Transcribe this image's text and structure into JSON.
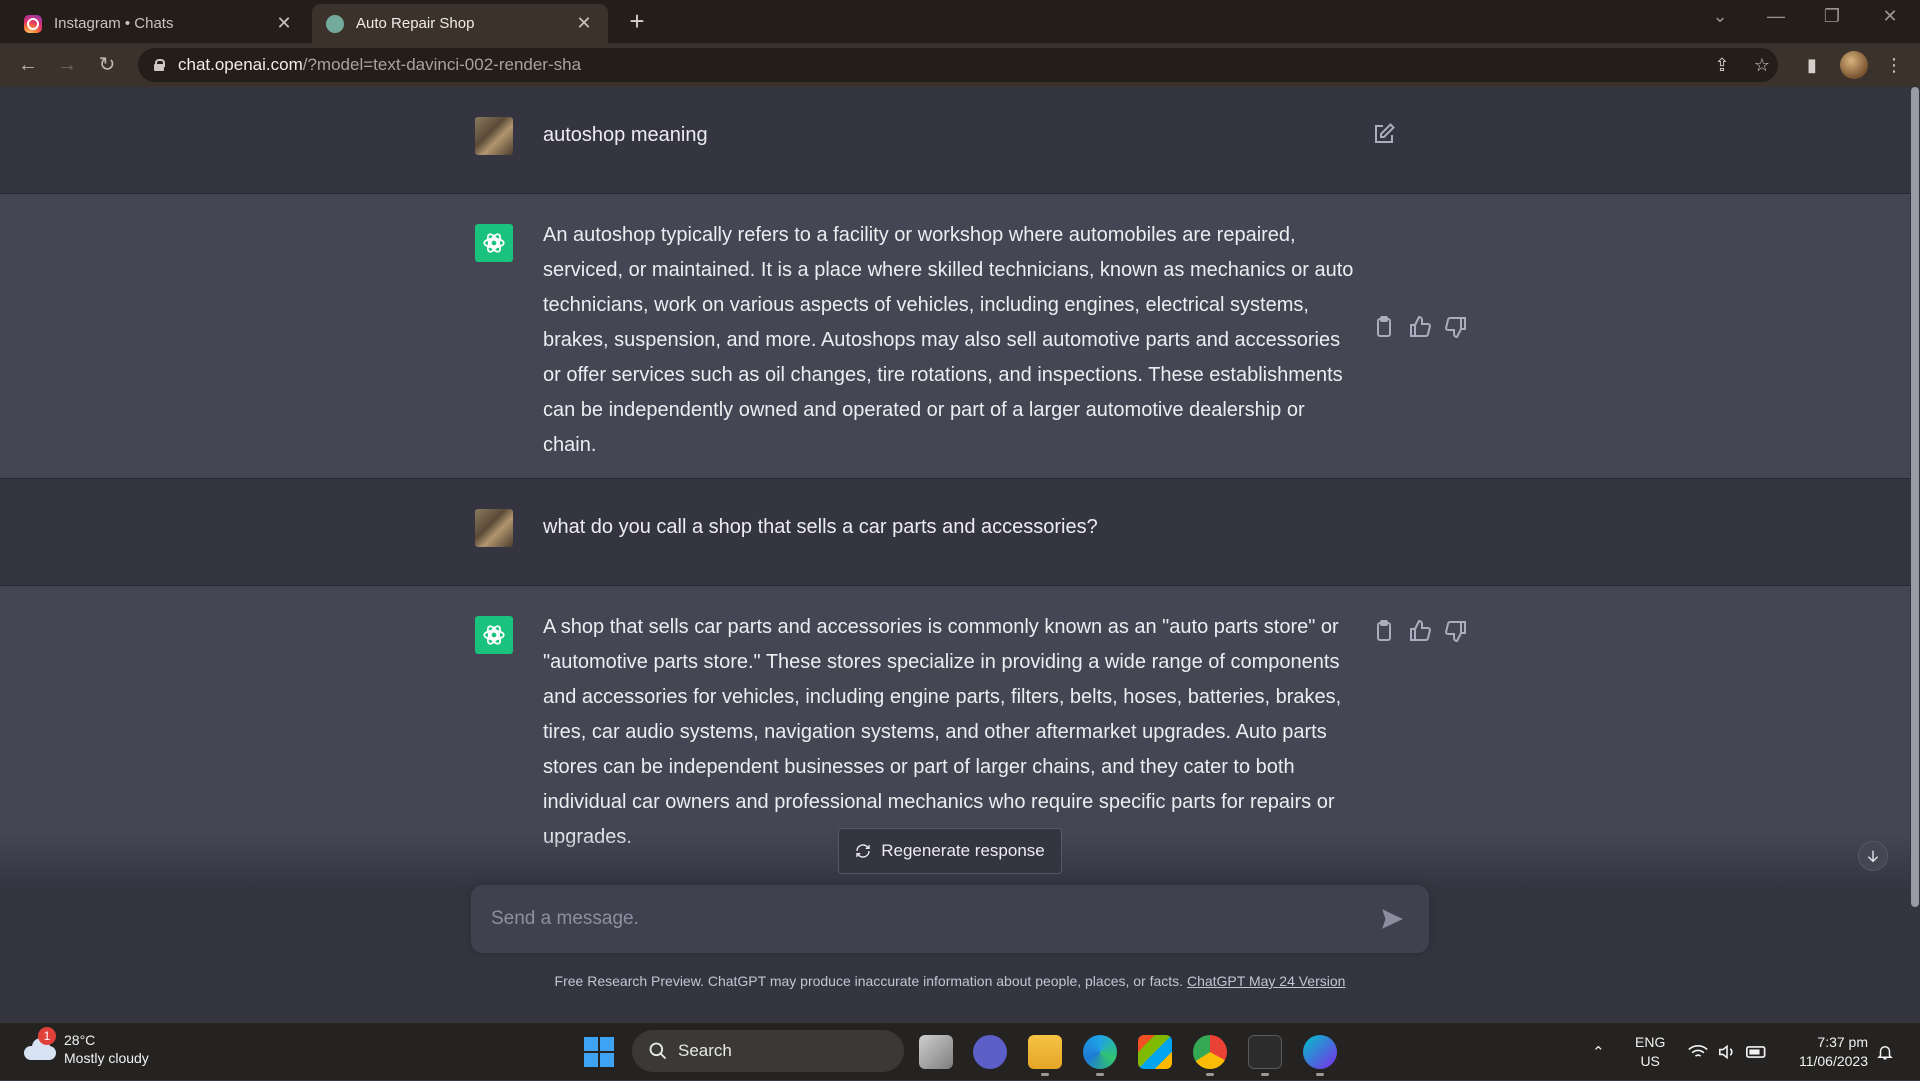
{
  "browser": {
    "tabs": [
      {
        "title": "Instagram • Chats",
        "active": false
      },
      {
        "title": "Auto Repair Shop",
        "active": true
      }
    ],
    "url_host": "chat.openai.com",
    "url_path": "/?model=text-davinci-002-render-sha"
  },
  "conversation": [
    {
      "role": "user",
      "text": "autoshop meaning"
    },
    {
      "role": "assistant",
      "text": "An autoshop typically refers to a facility or workshop where automobiles are repaired, serviced, or maintained. It is a place where skilled technicians, known as mechanics or auto technicians, work on various aspects of vehicles, including engines, electrical systems, brakes, suspension, and more. Autoshops may also sell automotive parts and accessories or offer services such as oil changes, tire rotations, and inspections. These establishments can be independently owned and operated or part of a larger automotive dealership or chain."
    },
    {
      "role": "user",
      "text": "what do you call a shop that sells a car parts and accessories?"
    },
    {
      "role": "assistant",
      "text": "A shop that sells car parts and accessories is commonly known as an \"auto parts store\" or \"automotive parts store.\" These stores specialize in providing a wide range of components and accessories for vehicles, including engine parts, filters, belts, hoses, batteries, brakes, tires, car audio systems, navigation systems, and other aftermarket upgrades. Auto parts stores can be independent businesses or part of larger chains, and they cater to both individual car owners and professional mechanics who require specific parts for repairs or upgrades."
    }
  ],
  "regenerate_label": "Regenerate response",
  "composer": {
    "placeholder": "Send a message."
  },
  "disclaimer": {
    "text": "Free Research Preview. ChatGPT may produce inaccurate information about people, places, or facts. ",
    "link": "ChatGPT May 24 Version"
  },
  "taskbar": {
    "weather_badge": "1",
    "temperature": "28°C",
    "condition": "Mostly cloudy",
    "search_label": "Search",
    "lang_top": "ENG",
    "lang_bottom": "US",
    "time": "7:37 pm",
    "date": "11/06/2023"
  },
  "colors": {
    "assistant_avatar": "#19c37d",
    "page_bg": "#343541",
    "assistant_row_bg": "#444654"
  }
}
